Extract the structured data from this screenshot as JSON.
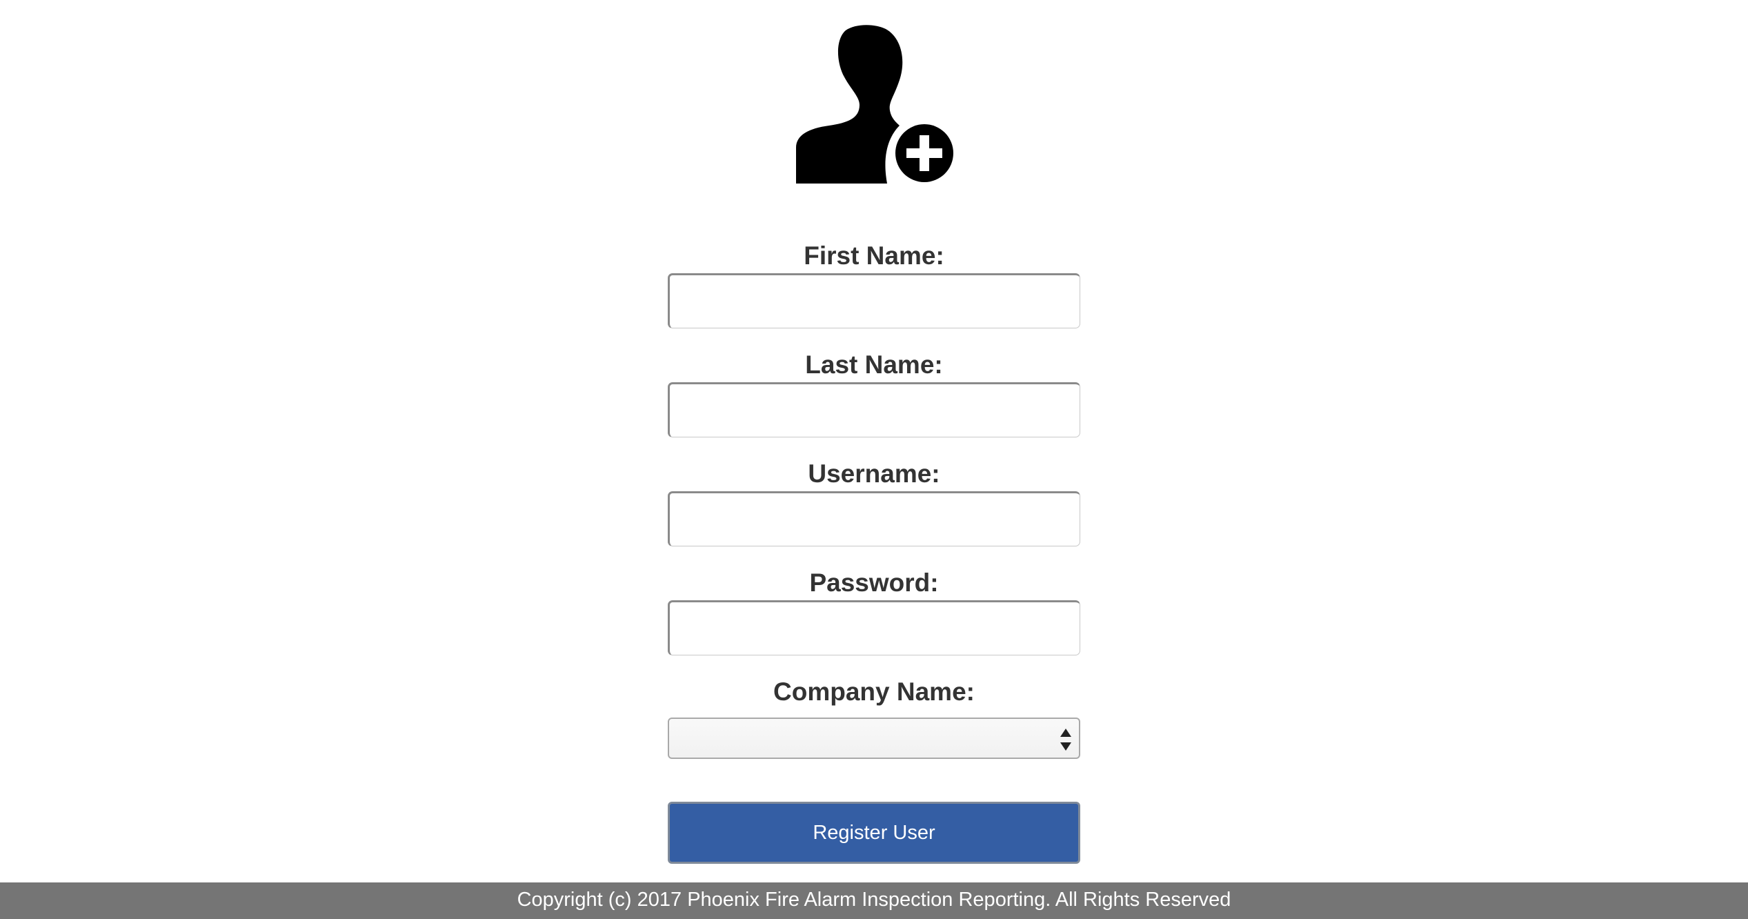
{
  "form": {
    "first_name_label": "First Name:",
    "first_name_value": "",
    "last_name_label": "Last Name:",
    "last_name_value": "",
    "username_label": "Username:",
    "username_value": "",
    "password_label": "Password:",
    "password_value": "",
    "company_label": "Company Name:",
    "company_selected": "",
    "register_label": "Register User"
  },
  "icons": {
    "header": "add-user-icon",
    "select": "select-arrows-icon"
  },
  "colors": {
    "button": "#345ea4",
    "footer": "#757575",
    "label": "#333333"
  },
  "footer": {
    "text": "Copyright (c) 2017 Phoenix Fire Alarm Inspection Reporting. All Rights Reserved"
  }
}
